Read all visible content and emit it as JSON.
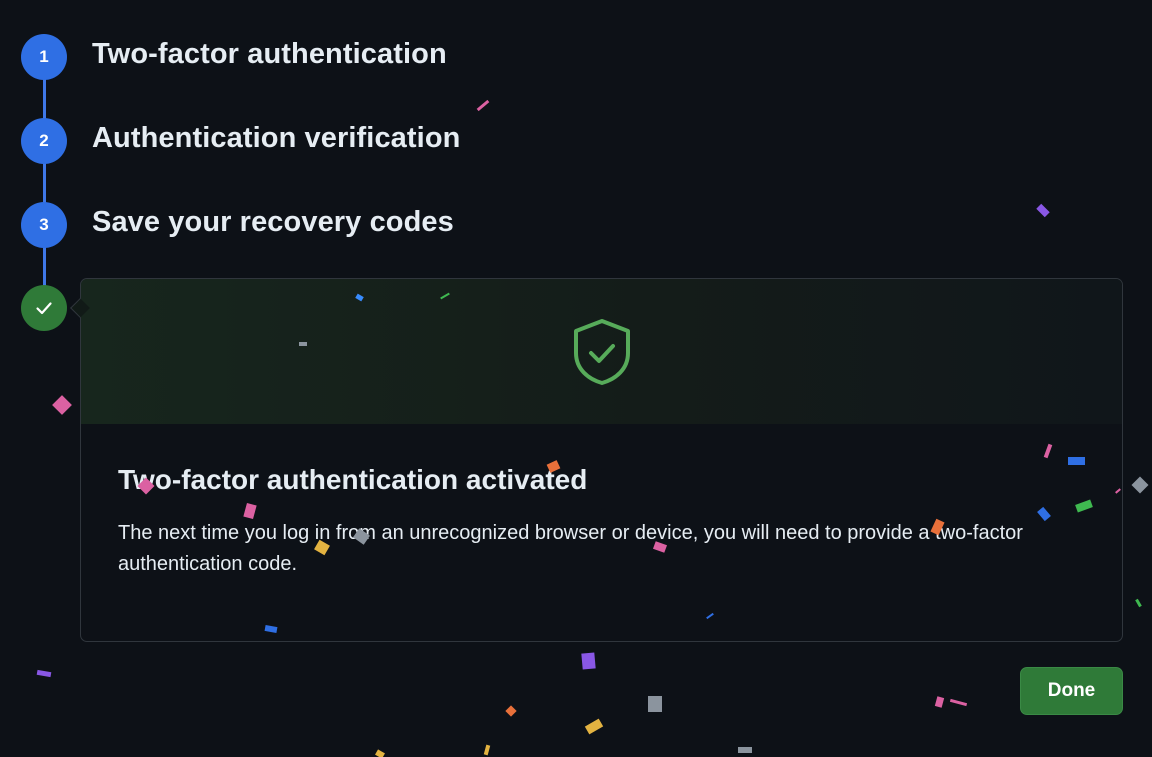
{
  "stepper": {
    "steps": [
      {
        "number": "1",
        "title": "Two-factor authentication"
      },
      {
        "number": "2",
        "title": "Authentication verification"
      },
      {
        "number": "3",
        "title": "Save your recovery codes"
      }
    ],
    "completed_icon": "check-icon"
  },
  "card": {
    "hero_icon": "shield-check-icon",
    "title": "Two-factor authentication activated",
    "text": "The next time you log in from an unrecognized browser or device, you will need to provide a two-factor authentication code."
  },
  "done_button": {
    "label": "Done"
  },
  "colors": {
    "background": "#0d1117",
    "step_blue": "#2f6fe4",
    "success_green": "#2f7a38",
    "shield_green": "#57ab5a"
  }
}
